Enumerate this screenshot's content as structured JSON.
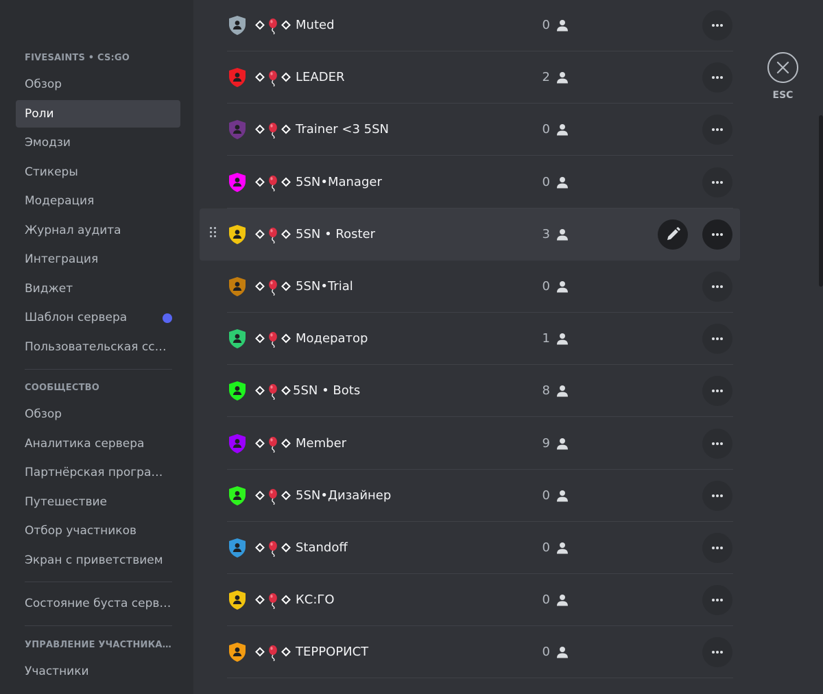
{
  "sidebar": {
    "sections": [
      {
        "header": "FIVESAINTS • CS:GO",
        "items": [
          {
            "label": "Обзор",
            "active": false
          },
          {
            "label": "Роли",
            "active": true
          },
          {
            "label": "Эмодзи",
            "active": false
          },
          {
            "label": "Стикеры",
            "active": false
          },
          {
            "label": "Модерация",
            "active": false
          },
          {
            "label": "Журнал аудита",
            "active": false
          },
          {
            "label": "Интеграция",
            "active": false
          },
          {
            "label": "Виджет",
            "active": false
          },
          {
            "label": "Шаблон сервера",
            "active": false,
            "dot": true
          },
          {
            "label": "Пользовательская ссылка приглашения",
            "active": false
          }
        ]
      },
      {
        "header": "СООБЩЕСТВО",
        "items": [
          {
            "label": "Обзор"
          },
          {
            "label": "Аналитика сервера"
          },
          {
            "label": "Партнёрская программа"
          },
          {
            "label": "Путешествие"
          },
          {
            "label": "Отбор участников"
          },
          {
            "label": "Экран с приветствием"
          }
        ]
      },
      {
        "header": "",
        "items": [
          {
            "label": "Состояние буста сервера"
          }
        ]
      },
      {
        "header": "УПРАВЛЕНИЕ УЧАСТНИКАМИ",
        "items": [
          {
            "label": "Участники"
          }
        ]
      }
    ],
    "notification_dot_color": "#5865f2"
  },
  "roles": [
    {
      "name": "Muted",
      "count": "0",
      "color": "#99aab5"
    },
    {
      "name": "LEADER",
      "count": "2",
      "color": "#ed1c24"
    },
    {
      "name": "Trainer <3 5SN",
      "count": "0",
      "color": "#71368a"
    },
    {
      "name": "5SN•Manager",
      "count": "0",
      "color": "#ff00ff"
    },
    {
      "name": "5SN • Roster",
      "count": "3",
      "color": "#f1c40f",
      "hovered": true
    },
    {
      "name": "5SN•Trial",
      "count": "0",
      "color": "#c27c0e"
    },
    {
      "name": "Модератор",
      "count": "1",
      "color": "#2ecc71"
    },
    {
      "name": "5SN • Bots",
      "count": "8",
      "color": "#1ef21e",
      "tight": true
    },
    {
      "name": "Member",
      "count": "9",
      "color": "#9b00ff"
    },
    {
      "name": "5SN•Дизайнер",
      "count": "0",
      "color": "#2ef21e"
    },
    {
      "name": "Standoff",
      "count": "0",
      "color": "#3498db"
    },
    {
      "name": "КС:ГО",
      "count": "0",
      "color": "#f1c40f"
    },
    {
      "name": "ТЕРРОРИСТ",
      "count": "0",
      "color": "#f39c12"
    }
  ],
  "close": {
    "label": "ESC"
  },
  "icons": {
    "role": "shield-icon",
    "members": "person-icon",
    "more": "more-dots-icon",
    "edit": "pencil-icon",
    "close": "close-icon",
    "drag": "drag-handle-icon"
  }
}
